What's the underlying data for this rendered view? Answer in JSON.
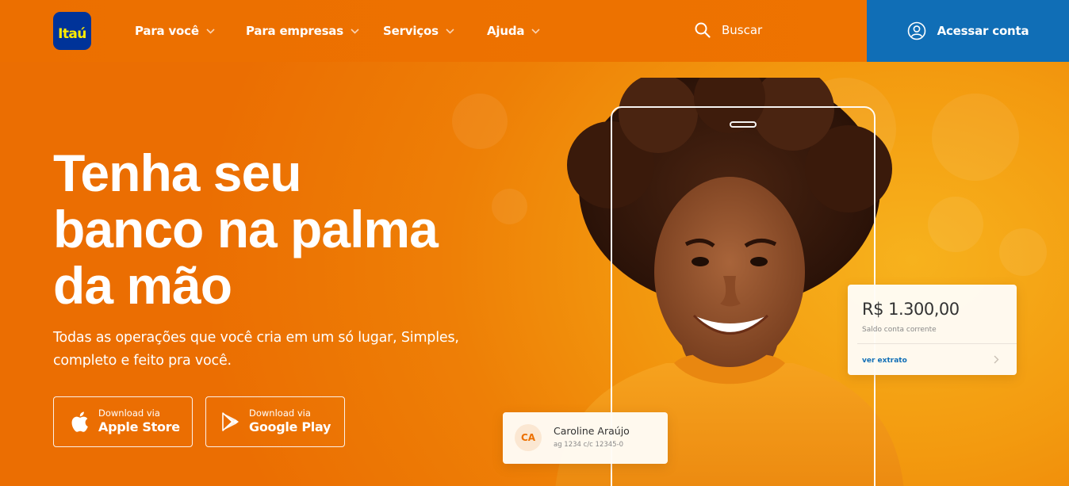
{
  "brand": {
    "logo_text": "Itaú",
    "primary_color": "#ec7000",
    "accent_blue": "#106eb6",
    "logo_bg": "#003399",
    "logo_fg": "#ffec00"
  },
  "nav": {
    "items": [
      {
        "label": "Para você"
      },
      {
        "label": "Para empresas"
      },
      {
        "label": "Serviços"
      },
      {
        "label": "Ajuda"
      }
    ],
    "search_label": "Buscar",
    "access_label": "Acessar conta"
  },
  "hero": {
    "headline_lines": [
      "Tenha seu",
      "banco na palma",
      "da mão"
    ],
    "subtext_lines": [
      "Todas as operações que você cria em um só lugar, Simples,",
      "completo e feito pra você."
    ],
    "apple": {
      "small": "Download via",
      "big": "Apple Store"
    },
    "google": {
      "small": "Download via",
      "big": "Google Play"
    }
  },
  "balance_card": {
    "amount": "R$ 1.300,00",
    "caption": "Saldo conta corrente",
    "link": "ver extrato"
  },
  "account_card": {
    "initials": "CA",
    "name": "Caroline Araújo",
    "details": "ag 1234  c/c 12345-0"
  },
  "icons": {
    "nav_chevron": "chevron-down-icon",
    "search": "search-icon",
    "account": "user-circle-icon",
    "apple": "apple-icon",
    "google_play": "google-play-icon",
    "balance_chevron": "chevron-right-icon"
  }
}
